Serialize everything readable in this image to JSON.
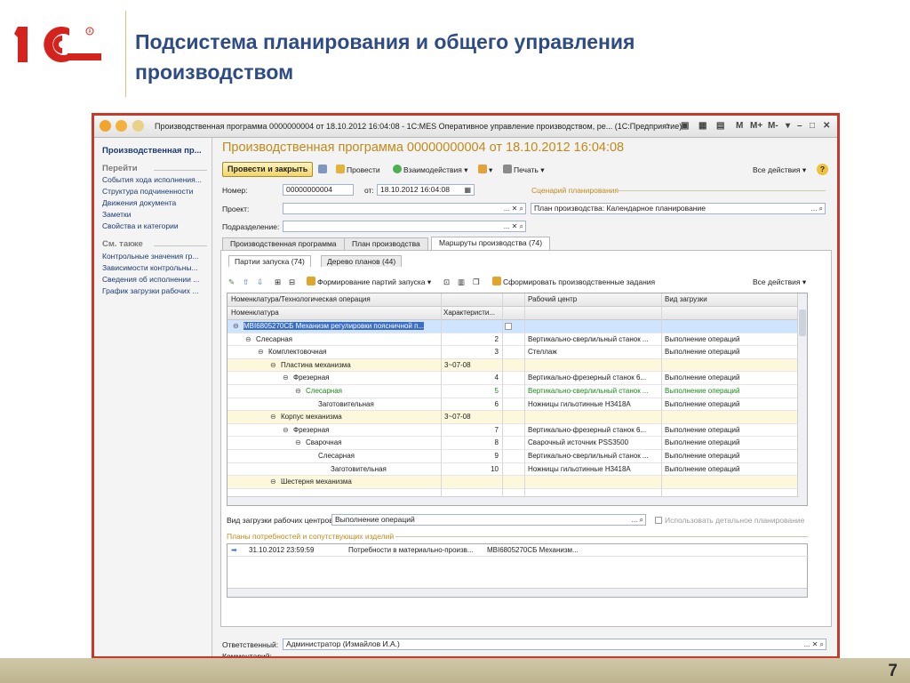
{
  "slide": {
    "title_line1": "Подсистема планирования и общего управления",
    "title_line2": "производством",
    "page_number": "7",
    "logo_text": "1С",
    "colors": {
      "title": "#2e4b86",
      "frame": "#c9392a",
      "logo": "#d4221d",
      "accent": "#c08a1a"
    }
  },
  "window": {
    "title": "Производственная программа 0000000004 от 18.10.2012 16:04:08 - 1С:MES Оперативное управление производством, ре...  (1С:Предприятие)",
    "buttons": [
      "M",
      "M+",
      "M-",
      "▾",
      "–",
      "□",
      "✕"
    ]
  },
  "sidebar": {
    "header": "Производственная пр...",
    "sec1": "Перейти",
    "goto": [
      "События хода исполнения...",
      "Структура подчиненности",
      "Движения документа",
      "Заметки",
      "Свойства и категории"
    ],
    "sec2": "См. также",
    "see_also": [
      "Контрольные значения гр...",
      "Зависимости контрольны...",
      "Сведения об исполнении ...",
      "График загрузки рабочих ..."
    ]
  },
  "doc": {
    "title": "Производственная программа 00000000004 от 18.10.2012 16:04:08",
    "toolbar": {
      "post_close": "Провести и закрыть",
      "post": "Провести",
      "interact": "Взаимодействия",
      "print": "Печать",
      "all_actions": "Все действия",
      "help": "?"
    },
    "number_label": "Номер:",
    "number": "00000000004",
    "date_label": "от:",
    "date": "18.10.2012 16:04:08",
    "project_label": "Проект:",
    "project": "",
    "division_label": "Подразделение:",
    "division": "",
    "scenario_group": "Сценарий планирования",
    "scenario": "План производства: Календарное планирование",
    "tabs": [
      "Производственная программа",
      "План производства",
      "Маршруты производства (74)"
    ],
    "subtabs": [
      "Партии запуска (74)",
      "Дерево планов (44)"
    ],
    "panel_toolbar": {
      "form_batches": "Формирование партий запуска",
      "form_tasks": "Сформировать производственные задания",
      "all_actions": "Все действия"
    },
    "grid": {
      "h1": [
        "Номенклатура/Технологическая операция",
        "Рабочий центр",
        "Вид загрузки"
      ],
      "h2": [
        "Номенклатура",
        "Характеристи..."
      ],
      "rows": [
        {
          "name": "MBI6805270СБ Механизм регулировки поясничной п...",
          "char": "",
          "num": "",
          "wc": "",
          "load": "",
          "style": "hl",
          "indent": 0
        },
        {
          "name": "Слесарная",
          "char": "",
          "num": "2",
          "wc": "Вертикально-сверлильный станок ...",
          "load": "Выполнение операций",
          "style": "",
          "indent": 1
        },
        {
          "name": "Комплектовочная",
          "char": "",
          "num": "3",
          "wc": "Стеллаж",
          "load": "Выполнение операций",
          "style": "",
          "indent": 2
        },
        {
          "name": "Пластина механизма",
          "char": "3~07-08",
          "num": "",
          "wc": "",
          "load": "",
          "style": "sel",
          "indent": 3
        },
        {
          "name": "Фрезерная",
          "char": "",
          "num": "4",
          "wc": "Вертикально-фрезерный станок 6...",
          "load": "Выполнение операций",
          "style": "",
          "indent": 4
        },
        {
          "name": "Слесарная",
          "char": "",
          "num": "5",
          "wc": "Вертикально-сверлильный станок ...",
          "load": "Выполнение операций",
          "style": "green",
          "indent": 5
        },
        {
          "name": "Заготовительная",
          "char": "",
          "num": "6",
          "wc": "Ножницы гильотинные Н3418А",
          "load": "Выполнение операций",
          "style": "",
          "indent": 6
        },
        {
          "name": "Корпус механизма",
          "char": "3~07-08",
          "num": "",
          "wc": "",
          "load": "",
          "style": "sel",
          "indent": 3
        },
        {
          "name": "Фрезерная",
          "char": "",
          "num": "7",
          "wc": "Вертикально-фрезерный станок 6...",
          "load": "Выполнение операций",
          "style": "",
          "indent": 4
        },
        {
          "name": "Сварочная",
          "char": "",
          "num": "8",
          "wc": "Сварочный источник PSS3500",
          "load": "Выполнение операций",
          "style": "",
          "indent": 5
        },
        {
          "name": "Слесарная",
          "char": "",
          "num": "9",
          "wc": "Вертикально-сверлильный станок ...",
          "load": "Выполнение операций",
          "style": "",
          "indent": 6
        },
        {
          "name": "Заготовительная",
          "char": "",
          "num": "10",
          "wc": "Ножницы гильотинные Н3418А",
          "load": "Выполнение операций",
          "style": "",
          "indent": 7
        },
        {
          "name": "Шестерня механизма",
          "char": "",
          "num": "",
          "wc": "",
          "load": "",
          "style": "sel",
          "indent": 3
        }
      ]
    },
    "load_type_label": "Вид загрузки рабочих центров:",
    "load_type": "Выполнение операций",
    "detailed_planning": "Использовать детальное планирование",
    "needs_group": "Планы потребностей и сопутствующих изделий",
    "needs_row": {
      "date": "31.10.2012 23:59:59",
      "type": "Потребности в материально-произв...",
      "item": "MBI6805270СБ Механизм..."
    },
    "responsible_label": "Ответственный:",
    "responsible": "Администратор (Измайлов И.А.)",
    "comment_label": "Комментарий:",
    "comment": ""
  }
}
